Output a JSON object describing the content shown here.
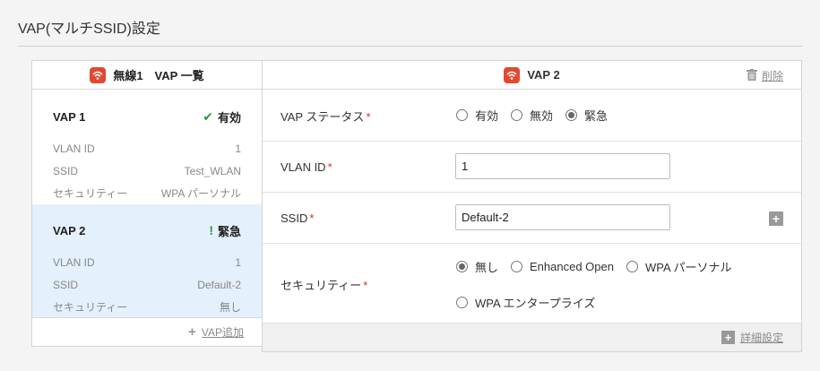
{
  "page": {
    "title": "VAP(マルチSSID)設定"
  },
  "left": {
    "header": "無線1　VAP 一覧",
    "vaps": [
      {
        "name": "VAP 1",
        "status": "有効",
        "status_icon": "check-icon",
        "vlan_label": "VLAN ID",
        "vlan": "1",
        "ssid_label": "SSID",
        "ssid": "Test_WLAN",
        "sec_label": "セキュリティー",
        "sec": "WPA パーソナル"
      },
      {
        "name": "VAP 2",
        "status": "緊急",
        "status_icon": "exclamation-icon",
        "vlan_label": "VLAN ID",
        "vlan": "1",
        "ssid_label": "SSID",
        "ssid": "Default-2",
        "sec_label": "セキュリティー",
        "sec": "無し"
      }
    ],
    "add_label": "VAP追加"
  },
  "right": {
    "header": "VAP 2",
    "delete_label": "削除",
    "status_label": "VAP ステータス",
    "status_options": [
      "有効",
      "無効",
      "緊急"
    ],
    "status_selected": "緊急",
    "vlan_label": "VLAN ID",
    "vlan_value": "1",
    "ssid_label": "SSID",
    "ssid_value": "Default-2",
    "security_label": "セキュリティー",
    "security_options": [
      "無し",
      "Enhanced Open",
      "WPA パーソナル",
      "WPA エンタープライズ"
    ],
    "security_selected": "無し",
    "required_mark": "*",
    "detail_label": "詳細設定"
  },
  "colors": {
    "accent": "#e2492f",
    "selected_bg": "#e4f0fb",
    "required": "#d0302a",
    "ok": "#2e9a3c"
  }
}
